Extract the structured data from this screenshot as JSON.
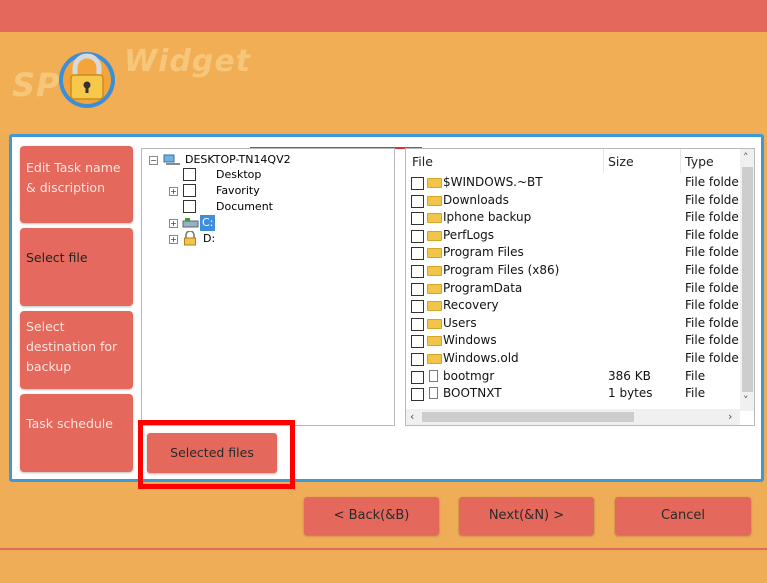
{
  "app": {
    "logo_left": "SP",
    "logo_right": "Widget"
  },
  "steps": [
    {
      "label": "Edit Task name & discription"
    },
    {
      "label": "Select file"
    },
    {
      "label": "Select destination for backup"
    },
    {
      "label": "Task schedule"
    }
  ],
  "tree": {
    "root": "DESKTOP-TN14QV2",
    "children": [
      "Desktop",
      "Favority",
      "Document"
    ],
    "drives": [
      "C:",
      "D:"
    ]
  },
  "file_list": {
    "columns": [
      "File",
      "Size",
      "Type"
    ],
    "rows": [
      {
        "name": "$WINDOWS.~BT",
        "size": "",
        "type": "File folde",
        "icon": "folder-icon"
      },
      {
        "name": "Downloads",
        "size": "",
        "type": "File folde",
        "icon": "folder-icon"
      },
      {
        "name": "Iphone backup",
        "size": "",
        "type": "File folde",
        "icon": "folder-icon"
      },
      {
        "name": "PerfLogs",
        "size": "",
        "type": "File folde",
        "icon": "folder-icon"
      },
      {
        "name": "Program Files",
        "size": "",
        "type": "File folde",
        "icon": "folder-icon"
      },
      {
        "name": "Program Files (x86)",
        "size": "",
        "type": "File folde",
        "icon": "folder-icon"
      },
      {
        "name": "ProgramData",
        "size": "",
        "type": "File folde",
        "icon": "folder-icon"
      },
      {
        "name": "Recovery",
        "size": "",
        "type": "File folde",
        "icon": "folder-icon"
      },
      {
        "name": "Users",
        "size": "",
        "type": "File folde",
        "icon": "folder-icon"
      },
      {
        "name": "Windows",
        "size": "",
        "type": "File folde",
        "icon": "folder-icon"
      },
      {
        "name": "Windows.old",
        "size": "",
        "type": "File folde",
        "icon": "folder-icon"
      },
      {
        "name": "bootmgr",
        "size": "386 KB",
        "type": "File",
        "icon": "file-icon"
      },
      {
        "name": "BOOTNXT",
        "size": "1 bytes",
        "type": "File",
        "icon": "file-icon"
      }
    ]
  },
  "buttons": {
    "selected_files": "Selected files",
    "back": "< Back(&B)",
    "next": "Next(&N) >",
    "cancel": "Cancel"
  },
  "colors": {
    "accent": "#e4685c",
    "header": "#f1ae55",
    "panel_border": "#3d9ad6",
    "highlight": "#ff0000"
  }
}
